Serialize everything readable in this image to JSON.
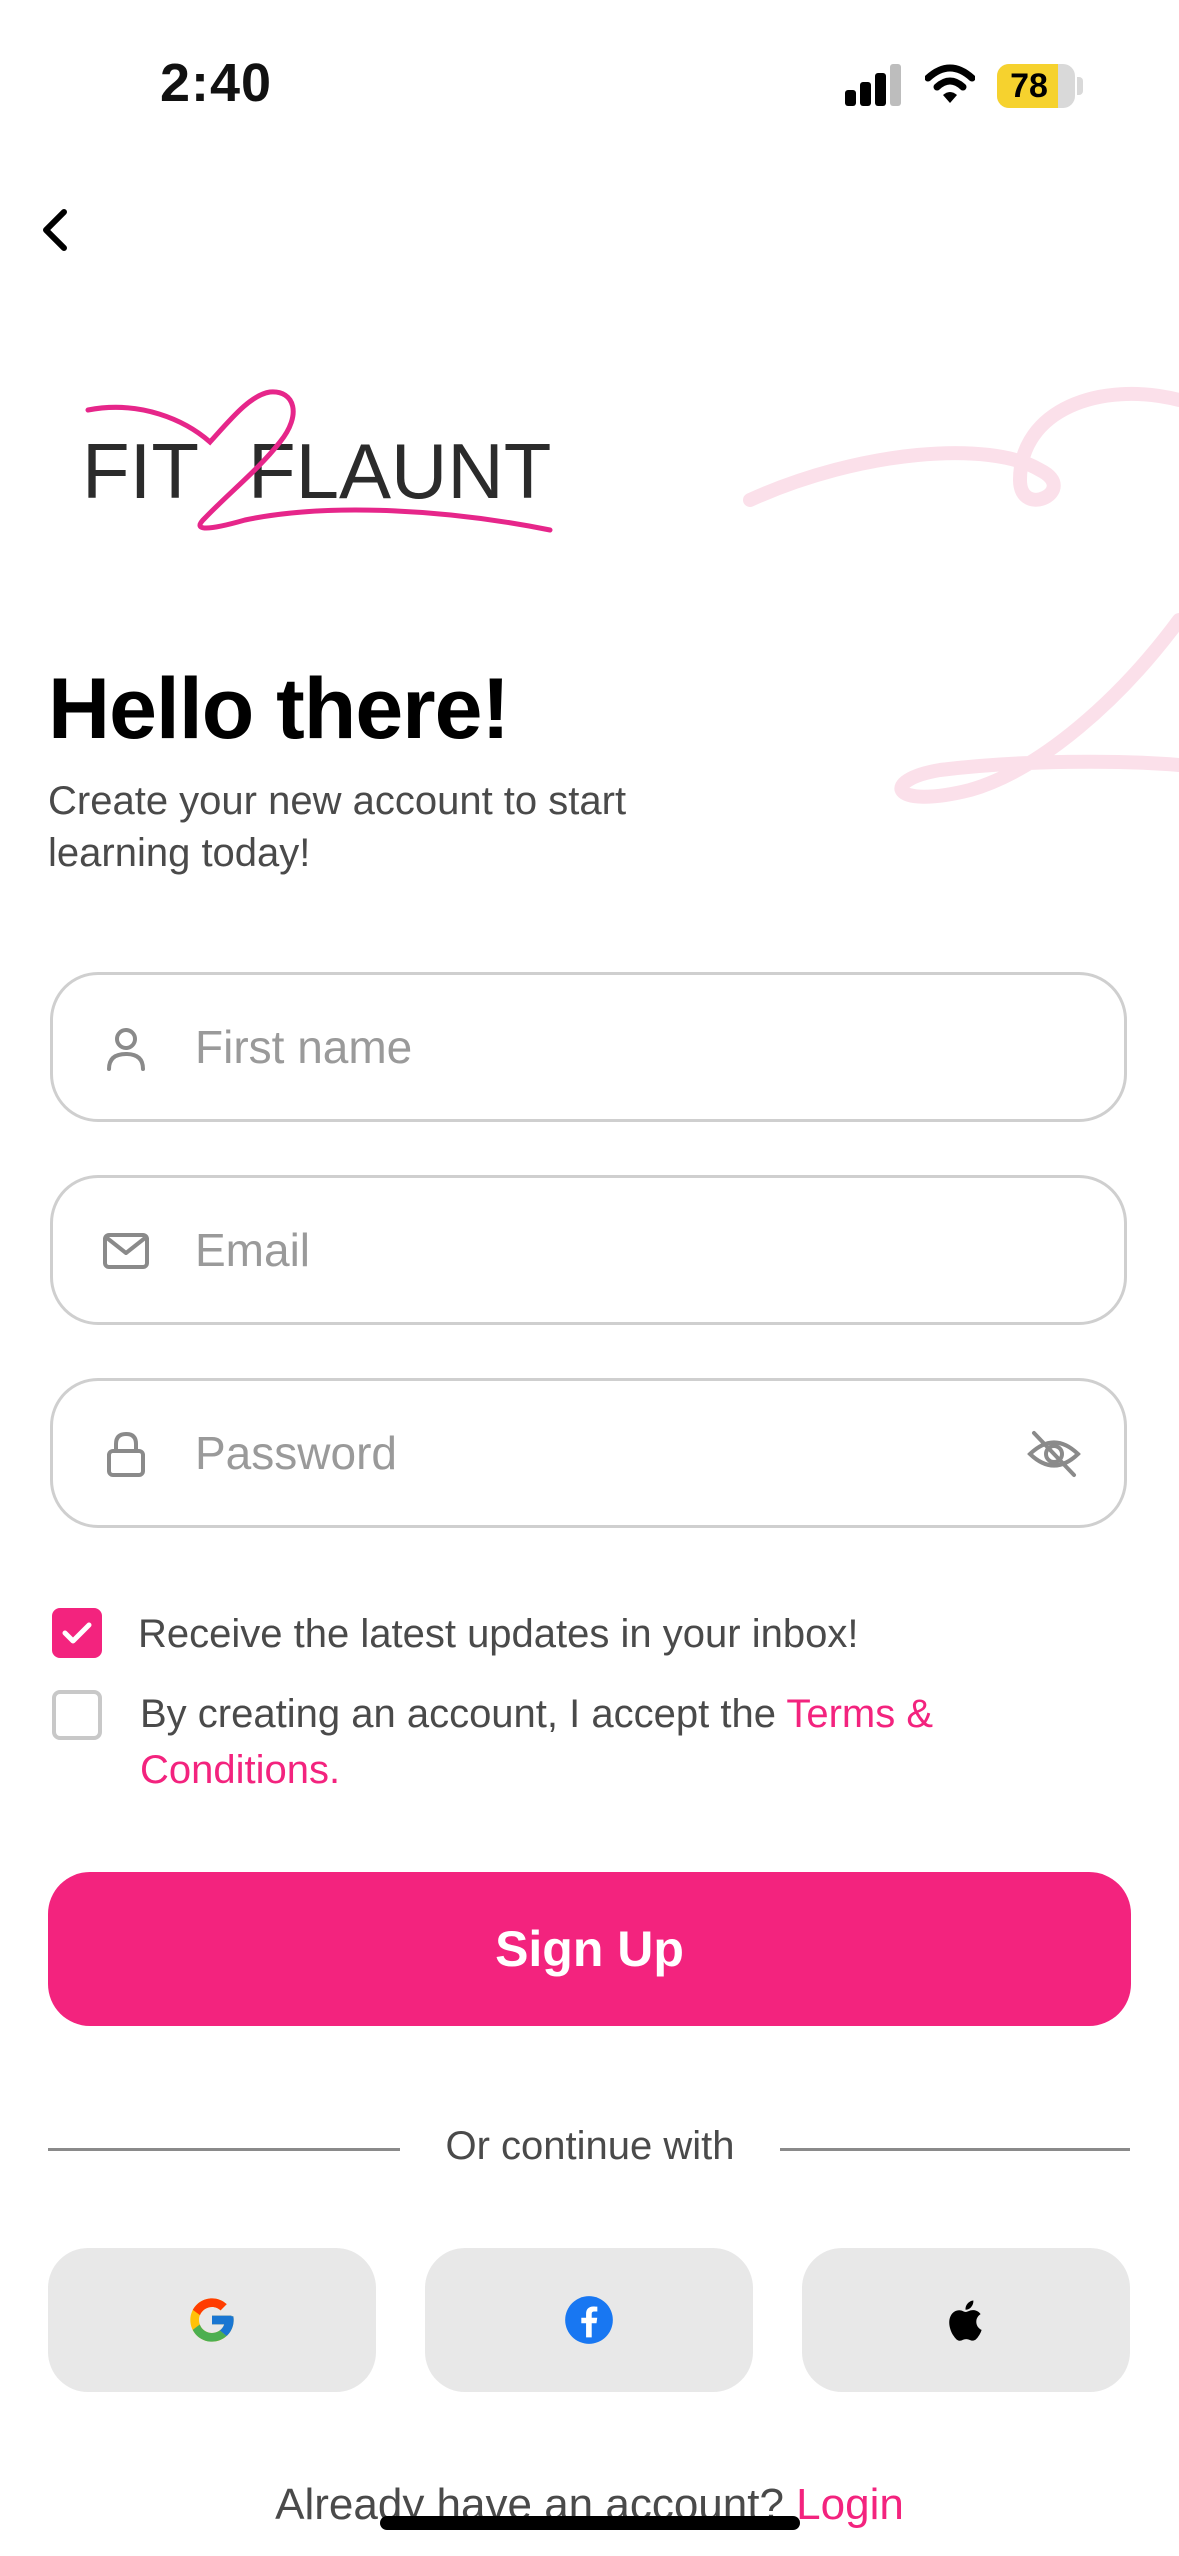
{
  "status_bar": {
    "time": "2:40",
    "battery": "78",
    "battery_level": 0.78
  },
  "logo": {
    "part1": "FIT",
    "part2": "FLAUNT"
  },
  "header": {
    "title": "Hello there!",
    "subtitle": "Create your new account to start learning today!"
  },
  "form": {
    "first_name_placeholder": "First name",
    "email_placeholder": "Email",
    "password_placeholder": "Password",
    "updates_label": "Receive the latest updates in your inbox!",
    "updates_checked": true,
    "terms_prefix": "By creating an account, I accept the ",
    "terms_link": "Terms & Conditions.",
    "terms_checked": false
  },
  "signup_label": "Sign Up",
  "divider_label": "Or continue with",
  "social": [
    "google-icon",
    "facebook-icon",
    "apple-icon"
  ],
  "footer": {
    "prompt": "Already have an account? ",
    "login": "Login"
  },
  "colors": {
    "accent": "#f3237e",
    "placeholder": "#9a9a9a",
    "field_border": "#cfcfcf",
    "social_bg": "#e8e8e8"
  }
}
